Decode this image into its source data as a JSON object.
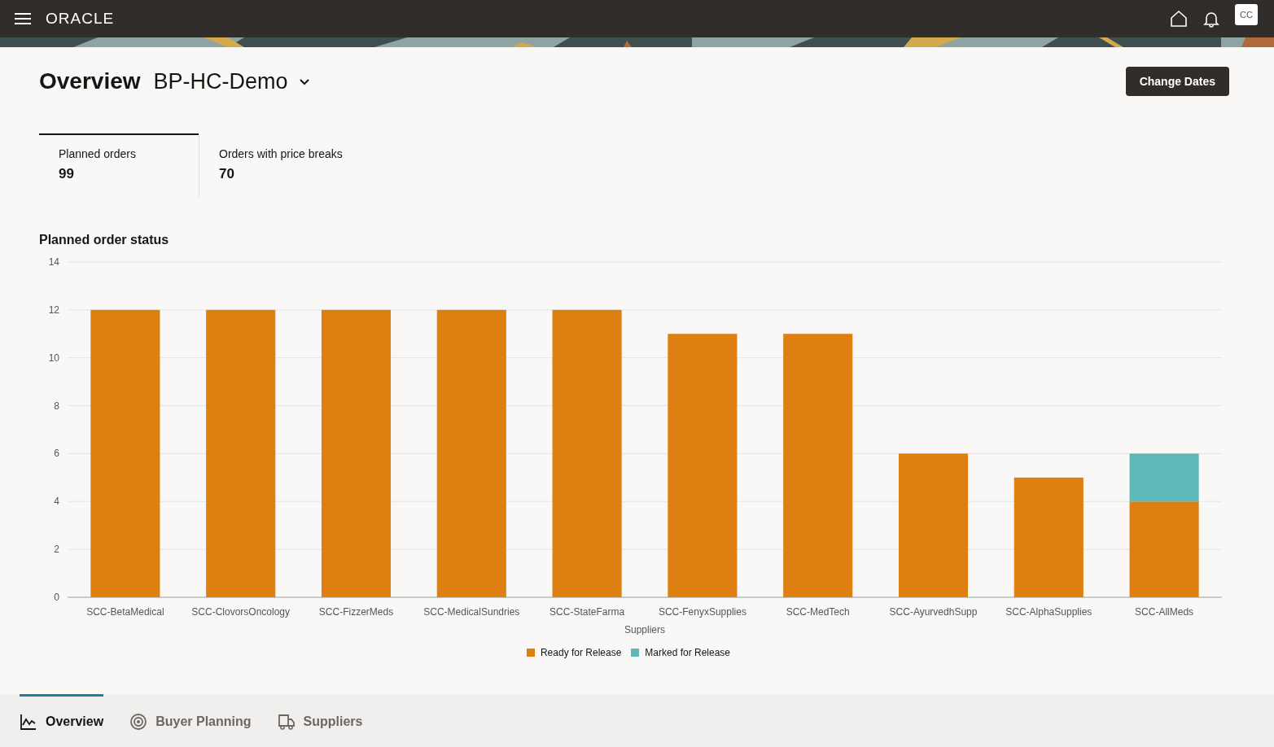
{
  "header": {
    "logo": "ORACLE",
    "avatar": "CC"
  },
  "page": {
    "title": "Overview",
    "plan": "BP-HC-Demo",
    "action": "Change Dates"
  },
  "metrics": [
    {
      "label": "Planned orders",
      "value": "99",
      "selected": true
    },
    {
      "label": "Orders with price breaks",
      "value": "70",
      "selected": false
    }
  ],
  "chart": {
    "title": "Planned order status",
    "chart_data": {
      "type": "bar",
      "stacked": true,
      "xlabel": "Suppliers",
      "categories": [
        "SCC-BetaMedical",
        "SCC-ClovorsOncology",
        "SCC-FizzerMeds",
        "SCC-MedicalSundries",
        "SCC-StateFarma",
        "SCC-FenyxSupplies",
        "SCC-MedTech",
        "SCC-AyurvedhSupp",
        "SCC-AlphaSupplies",
        "SCC-AllMeds"
      ],
      "series": [
        {
          "name": "Ready for Release",
          "color": "#dd7f11",
          "values": [
            12,
            12,
            12,
            12,
            12,
            11,
            11,
            6,
            5,
            4
          ]
        },
        {
          "name": "Marked for Release",
          "color": "#5fb8b7",
          "values": [
            0,
            0,
            0,
            0,
            0,
            0,
            0,
            0,
            0,
            2
          ]
        }
      ],
      "grid": true,
      "ylim": [
        0,
        14
      ],
      "yticks": [
        0,
        2,
        4,
        6,
        8,
        10,
        12,
        14
      ]
    }
  },
  "nav": [
    {
      "label": "Overview",
      "selected": true
    },
    {
      "label": "Buyer Planning",
      "selected": false
    },
    {
      "label": "Suppliers",
      "selected": false
    }
  ]
}
